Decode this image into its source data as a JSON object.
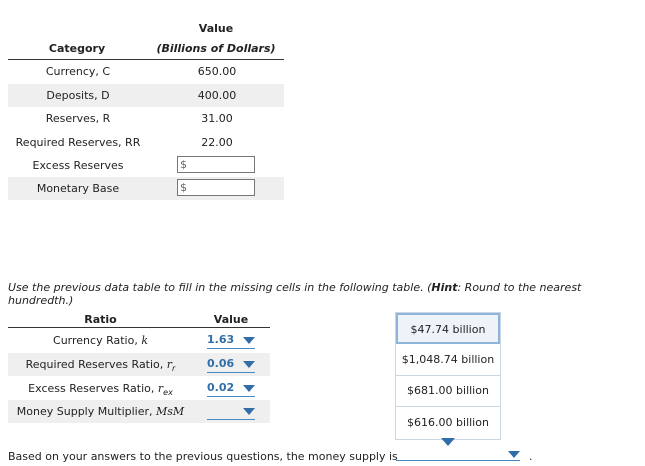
{
  "table1": {
    "header_value": "Value",
    "header_category": "Category",
    "header_units": "(Billions of Dollars)",
    "rows": [
      {
        "category": "Currency, C",
        "value": "650.00"
      },
      {
        "category": "Deposits, D",
        "value": "400.00"
      },
      {
        "category": "Reserves, R",
        "value": "31.00"
      },
      {
        "category": "Required Reserves, RR",
        "value": "22.00"
      },
      {
        "category": "Excess Reserves",
        "input_prefix": "$"
      },
      {
        "category": "Monetary Base",
        "input_prefix": "$"
      }
    ]
  },
  "instruction": {
    "before": "Use the previous data table to fill in the missing cells in the following table. (",
    "hint": "Hint",
    "after": ": Round to the nearest hundredth.)"
  },
  "table2": {
    "header_ratio": "Ratio",
    "header_value": "Value",
    "rows": [
      {
        "label_text": "Currency Ratio, ",
        "symbol": "k",
        "value": "1.63"
      },
      {
        "label_text": "Required Reserves Ratio, ",
        "symbol": "r",
        "subscript": "r",
        "value": "0.06"
      },
      {
        "label_text": "Excess Reserves Ratio, ",
        "symbol": "r",
        "subscript": "ex",
        "value": "0.02"
      },
      {
        "label_text": "Money Supply Multiplier, ",
        "symbol": "MsM",
        "value": ""
      }
    ]
  },
  "dropdown_menu": {
    "options": [
      "$47.74 billion",
      "$1,048.74 billion",
      "$681.00 billion",
      "$616.00 billion"
    ],
    "highlighted_index": 0
  },
  "bottom": {
    "text": "Based on your answers to the previous questions, the money supply is",
    "period": "."
  },
  "colors": {
    "accent": "#2f6ea8",
    "shade": "#efefef",
    "menu_border": "#c9d6e4"
  },
  "icons": {
    "dropdown": "caret-down-icon"
  }
}
